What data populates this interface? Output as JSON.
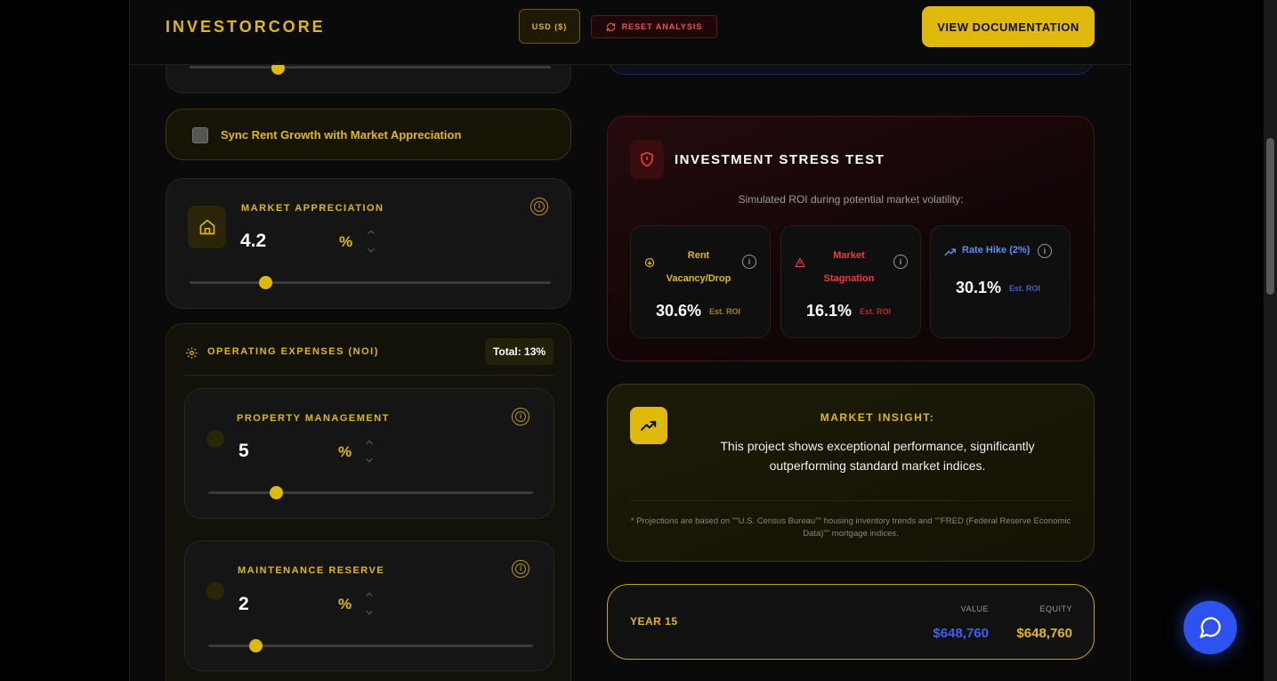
{
  "header": {
    "brand": "INVESTORCORE",
    "currency_label": "USD ($)",
    "reset_label": "RESET ANALYSIS",
    "docs_label": "VIEW DOCUMENTATION"
  },
  "sync": {
    "label": "Sync Rent Growth with Market Appreciation",
    "checked": false
  },
  "market_appreciation": {
    "label": "MARKET APPRECIATION",
    "value": "4.2",
    "unit": "%",
    "slider_fraction": 0.21
  },
  "opex": {
    "title": "OPERATING EXPENSES (NOI)",
    "total": "Total: 13%",
    "items": [
      {
        "label": "PROPERTY MANAGEMENT",
        "value": "5",
        "unit": "%",
        "slider_fraction": 0.21
      },
      {
        "label": "MAINTENANCE RESERVE",
        "value": "2",
        "unit": "%",
        "slider_fraction": 0.15
      }
    ]
  },
  "stress_test": {
    "title": "INVESTMENT STRESS TEST",
    "subtitle": "Simulated ROI during potential market volatility:",
    "scenarios": [
      {
        "line1": "Rent",
        "line2": "Vacancy/Drop",
        "value": "30.6%",
        "tag": "Est. ROI",
        "color": "#e0b90d",
        "icon": "arrow-down-circle-icon"
      },
      {
        "line1": "Market",
        "line2": "Stagnation",
        "value": "16.1%",
        "tag": "Est. ROI",
        "color": "#ef3b3b",
        "icon": "warning-triangle-icon"
      },
      {
        "line1": "Rate Hike (2%)",
        "line2": "",
        "value": "30.1%",
        "tag": "Est. ROI",
        "color": "#5b8ff0",
        "icon": "trending-up-icon"
      }
    ]
  },
  "insight": {
    "title": "MARKET INSIGHT:",
    "body": "This project shows exceptional performance, significantly outperforming standard market indices.",
    "footnote": "* Projections are based on \"\"U.S. Census Bureau\"\" housing inventory trends and \"\"FRED (Federal Reserve Economic Data)\"\" mortgage indices."
  },
  "year_summary": {
    "label": "YEAR 15",
    "value_header": "VALUE",
    "equity_header": "EQUITY",
    "value": "$648,760",
    "equity": "$648,760"
  },
  "colors": {
    "accent": "#e0b90d",
    "danger": "#ef3b3b",
    "info": "#5b8ff0",
    "chat": "#2e52f0"
  }
}
